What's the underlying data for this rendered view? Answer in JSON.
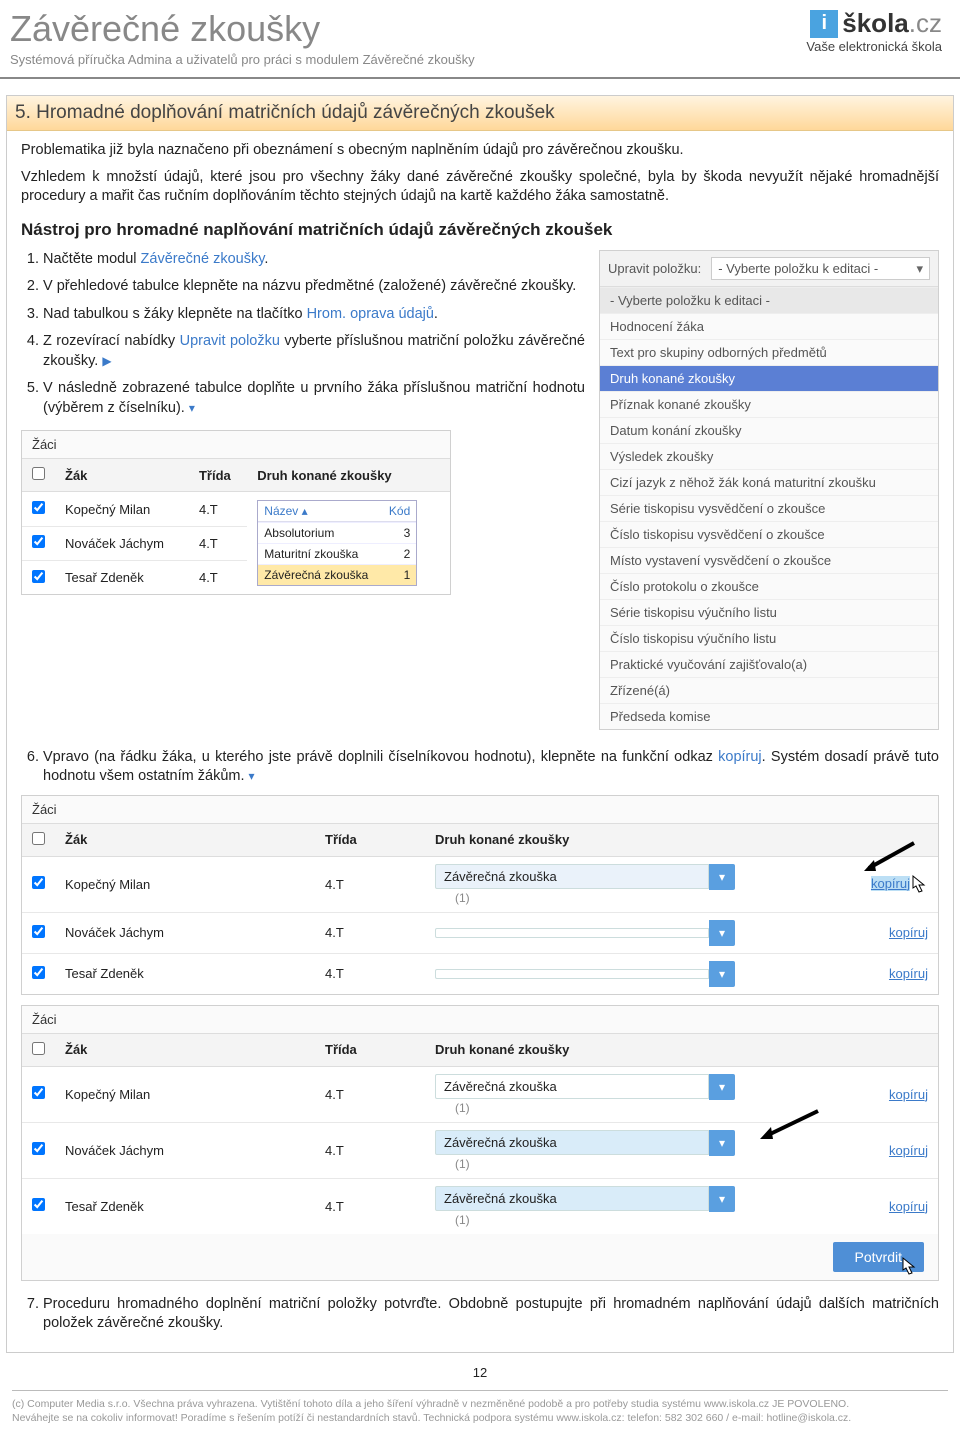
{
  "header": {
    "title": "Závěrečné zkoušky",
    "subtitle": "Systémová příručka Admina a uživatelů pro práci s modulem Závěrečné zkoušky",
    "logo_i": "i",
    "logo_text": "škola",
    "logo_cz": ".cz",
    "tagline": "Vaše elektronická škola"
  },
  "section": {
    "title": "5. Hromadné doplňování matričních údajů závěrečných zkoušek",
    "p1": "Problematika již byla naznačeno při obeznámení s obecným naplněním údajů pro závěrečnou zkoušku.",
    "p2": "Vzhledem k množstí údajů, které jsou pro všechny žáky dané závěrečné zkoušky společné, byla by škoda nevyužít nějaké hromadnější procedury a mařit čas ručním doplňováním těchto stejných údajů na kartě každého žáka samostatně.",
    "sub": "Nástroj pro hromadné naplňování matričních údajů závěrečných zkoušek"
  },
  "steps": {
    "s1a": "Načtěte modul ",
    "s1b": "Závěrečné zkoušky",
    "s2": "V přehledové tabulce klepněte na názvu předmětné (založené) závěrečné zkoušky.",
    "s3a": "Nad tabulkou s žáky klepněte na tlačítko ",
    "s3b": "Hrom. oprava údajů",
    "s4a": "Z rozevírací nabídky ",
    "s4b": "Upravit položku",
    "s4c": " vyberte příslušnou matriční položku závěrečné zkoušky.",
    "s5": "V následně zobrazené tabulce doplňte u prvního žáka příslušnou matriční hodnotu (výběrem z číselníku).",
    "s6a": "Vpravo (na řádku žáka, u kterého jste právě doplnili číselníkovou hodnotu), klepněte na funkční odkaz ",
    "s6b": "kopíruj",
    "s6c": ". Systém dosadí právě tuto hodnotu všem ostatním žákům.",
    "s7": "Proceduru hromadného doplnění matriční položky potvrďte. Obdobně postupujte při hromadném naplňování údajů dalších matričních položek závěrečné zkoušky."
  },
  "select_panel": {
    "label": "Upravit položku:",
    "placeholder": "- Vyberte položku k editaci -",
    "items": [
      "- Vyberte položku k editaci -",
      "Hodnocení žáka",
      "Text pro skupiny odborných předmětů",
      "Druh konané zkoušky",
      "Příznak konané zkoušky",
      "Datum konání zkoušky",
      "Výsledek zkoušky",
      "Cizí jazyk z něhož žák koná maturitní zkoušku",
      "Série tiskopisu vysvědčení o zkoušce",
      "Číslo tiskopisu vysvědčení o zkoušce",
      "Místo vystavení vysvědčení o zkoušce",
      "Číslo protokolu o zkoušce",
      "Série tiskopisu výučního listu",
      "Číslo tiskopisu výučního listu",
      "Praktické vyučování zajišťovalo(a)",
      "Zřízené(á)",
      "Předseda komise"
    ],
    "selected_index": 3
  },
  "zaci1": {
    "title": "Žáci",
    "cols": {
      "c1": "Žák",
      "c2": "Třída",
      "c3": "Druh konané zkoušky"
    },
    "rows": [
      {
        "name": "Kopečný Milan",
        "class": "4.T"
      },
      {
        "name": "Nováček Jáchym",
        "class": "4.T"
      },
      {
        "name": "Tesař Zdeněk",
        "class": "4.T"
      }
    ],
    "dropdown": {
      "hdr_name": "Název ▴",
      "hdr_code": "Kód",
      "opts": [
        {
          "n": "Absolutorium",
          "k": "3"
        },
        {
          "n": "Maturitní zkouška",
          "k": "2"
        },
        {
          "n": "Závěrečná zkouška",
          "k": "1"
        }
      ],
      "hi_index": 2
    }
  },
  "zaci2": {
    "title": "Žáci",
    "cols": {
      "c1": "Žák",
      "c2": "Třída",
      "c3": "Druh konané zkoušky"
    },
    "rows": [
      {
        "name": "Kopečný Milan",
        "class": "4.T",
        "val": "Závěrečná zkouška",
        "count": "(1)",
        "link": "kopíruj",
        "hi": true
      },
      {
        "name": "Nováček Jáchym",
        "class": "4.T",
        "val": "",
        "count": "",
        "link": "kopíruj",
        "hi": false
      },
      {
        "name": "Tesař Zdeněk",
        "class": "4.T",
        "val": "",
        "count": "",
        "link": "kopíruj",
        "hi": false
      }
    ]
  },
  "zaci3": {
    "title": "Žáci",
    "cols": {
      "c1": "Žák",
      "c2": "Třída",
      "c3": "Druh konané zkoušky"
    },
    "rows": [
      {
        "name": "Kopečný Milan",
        "class": "4.T",
        "val": "Závěrečná zkouška",
        "count": "(1)",
        "link": "kopíruj"
      },
      {
        "name": "Nováček Jáchym",
        "class": "4.T",
        "val": "Závěrečná zkouška",
        "count": "(1)",
        "link": "kopíruj"
      },
      {
        "name": "Tesař Zdeněk",
        "class": "4.T",
        "val": "Závěrečná zkouška",
        "count": "(1)",
        "link": "kopíruj"
      }
    ],
    "confirm": "Potvrdit"
  },
  "page_num": "12",
  "footer": {
    "l1": "(c) Computer Media s.r.o. Všechna práva vyhrazena. Vytištění tohoto díla a jeho šíření výhradně v nezměněné podobě a pro potřeby studia systému www.iskola.cz JE POVOLENO.",
    "l2": "Neváhejte se na cokoliv informovat! Poradíme s řešením potíží či nestandardních stavů. Technická podpora systému www.iskola.cz: telefon: 582 302 660 / e-mail: hotline@iskola.cz."
  }
}
